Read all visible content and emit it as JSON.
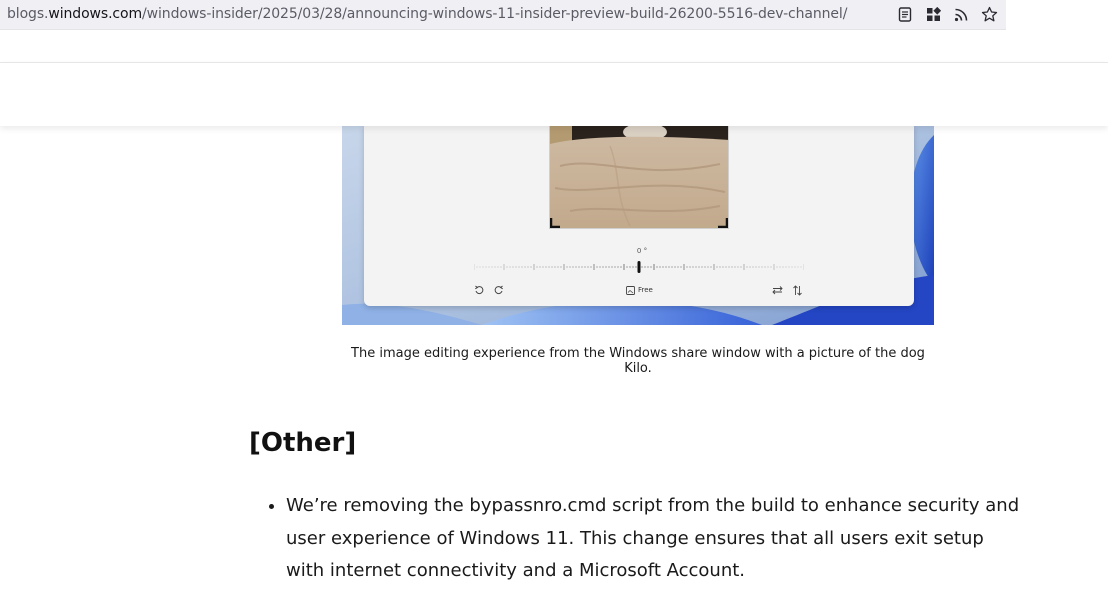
{
  "browser": {
    "url_host_prefix": "blogs.",
    "url_host": "windows.com",
    "url_path": "/windows-insider/2025/03/28/announcing-windows-11-insider-preview-build-26200-5516-dev-channel/",
    "icons": [
      "reader-view-icon",
      "extensions-icon",
      "rss-feed-icon",
      "bookmark-star-icon"
    ]
  },
  "figure": {
    "angle_readout": "0 °",
    "tools": {
      "free_label": "Free"
    },
    "caption": "The image editing experience from the Windows share window with a picture of the dog Kilo."
  },
  "section": {
    "heading": "[Other]",
    "bullets": [
      "We’re removing the bypassnro.cmd script from the build to enhance security and user experience of Windows 11. This change ensures that all users exit setup with internet connectivity and a Microsoft Account."
    ]
  },
  "colors": {
    "accent_blue": "#2b61d6",
    "text": "#1a1a1a"
  }
}
